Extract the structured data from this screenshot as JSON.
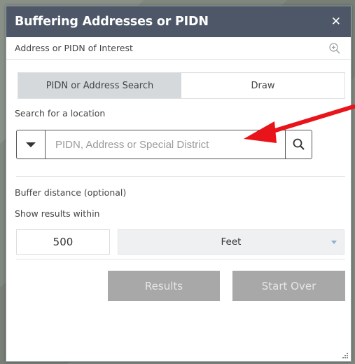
{
  "panel": {
    "title": "Buffering Addresses or PIDN",
    "subheader": "Address or PIDN of Interest",
    "icons": {
      "close": "close-icon",
      "zoom": "zoom-in-icon",
      "search": "search-icon",
      "dropdown": "caret-down-icon"
    }
  },
  "tabs": [
    {
      "label": "PIDN or Address Search",
      "active": true
    },
    {
      "label": "Draw",
      "active": false
    }
  ],
  "search": {
    "label": "Search for a location",
    "placeholder": "PIDN, Address or Special District"
  },
  "buffer": {
    "label": "Buffer distance (optional)",
    "show_label": "Show results within",
    "distance": "500",
    "unit": "Feet"
  },
  "buttons": {
    "results": "Results",
    "start_over": "Start Over"
  },
  "colors": {
    "titlebar": "#4d5767",
    "annotation_arrow": "#e8141a",
    "button_disabled": "#a8a8a8"
  }
}
